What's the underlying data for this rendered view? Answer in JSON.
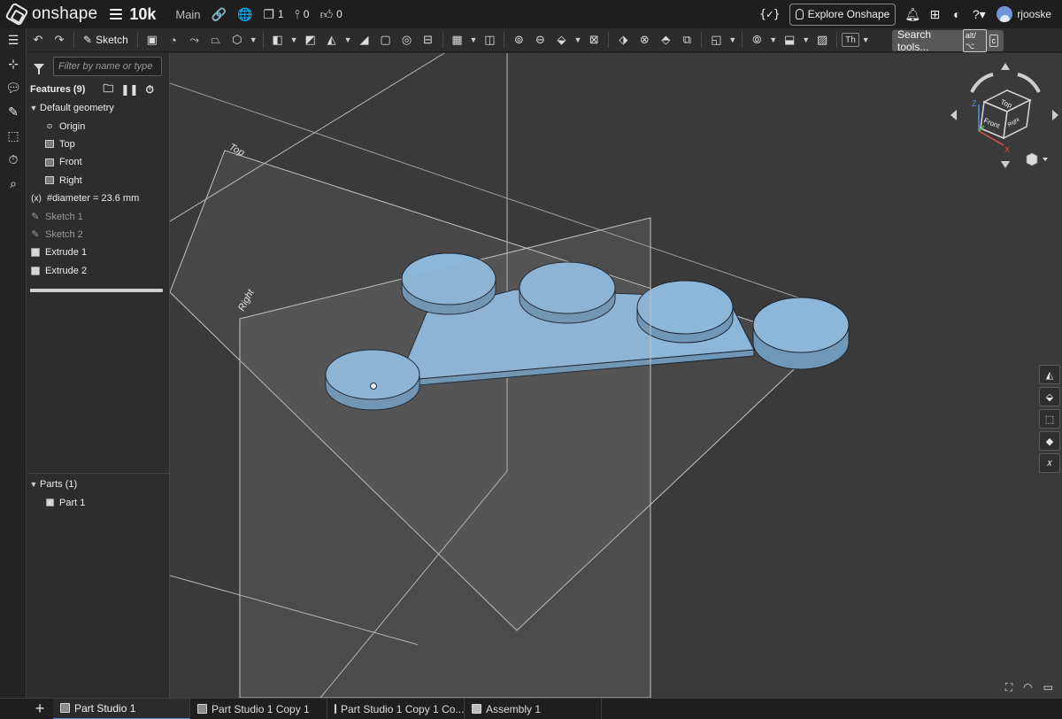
{
  "header": {
    "app_name": "onshape",
    "doc_title": "10k",
    "branch": "Main",
    "versions_count": "1",
    "followers_count": "0",
    "likes_count": "0",
    "code_label": "{✓}",
    "explore_label": "Explore Onshape",
    "username": "rjooske"
  },
  "toolbar": {
    "sketch_label": "Sketch",
    "th_label": "Th",
    "search_label": "Search tools...",
    "search_kbd1": "alt/⌥",
    "search_kbd2": "c"
  },
  "feature_panel": {
    "filter_placeholder": "Filter by name or type",
    "features_title": "Features (9)",
    "default_geometry": "Default geometry",
    "origin": "Origin",
    "top": "Top",
    "front": "Front",
    "right": "Right",
    "variable": "#diameter = 23.6 mm",
    "variable_icon": "(x)",
    "sketch1": "Sketch 1",
    "sketch2": "Sketch 2",
    "extrude1": "Extrude 1",
    "extrude2": "Extrude 2",
    "parts_title": "Parts (1)",
    "part1": "Part 1"
  },
  "viewport": {
    "plane_top": "Top",
    "plane_right": "Right",
    "viewcube_top": "Top",
    "viewcube_front": "Front",
    "viewcube_right": "Right",
    "axis_x": "X",
    "axis_z": "Z"
  },
  "tabs": [
    {
      "label": "Part Studio 1"
    },
    {
      "label": "Part Studio 1 Copy 1"
    },
    {
      "label": "Part Studio 1 Copy 1 Co..."
    },
    {
      "label": "Assembly 1"
    }
  ],
  "colors": {
    "part_fill": "#8db7d9",
    "part_side": "#6f97b8",
    "accent": "#5a8fd6"
  }
}
